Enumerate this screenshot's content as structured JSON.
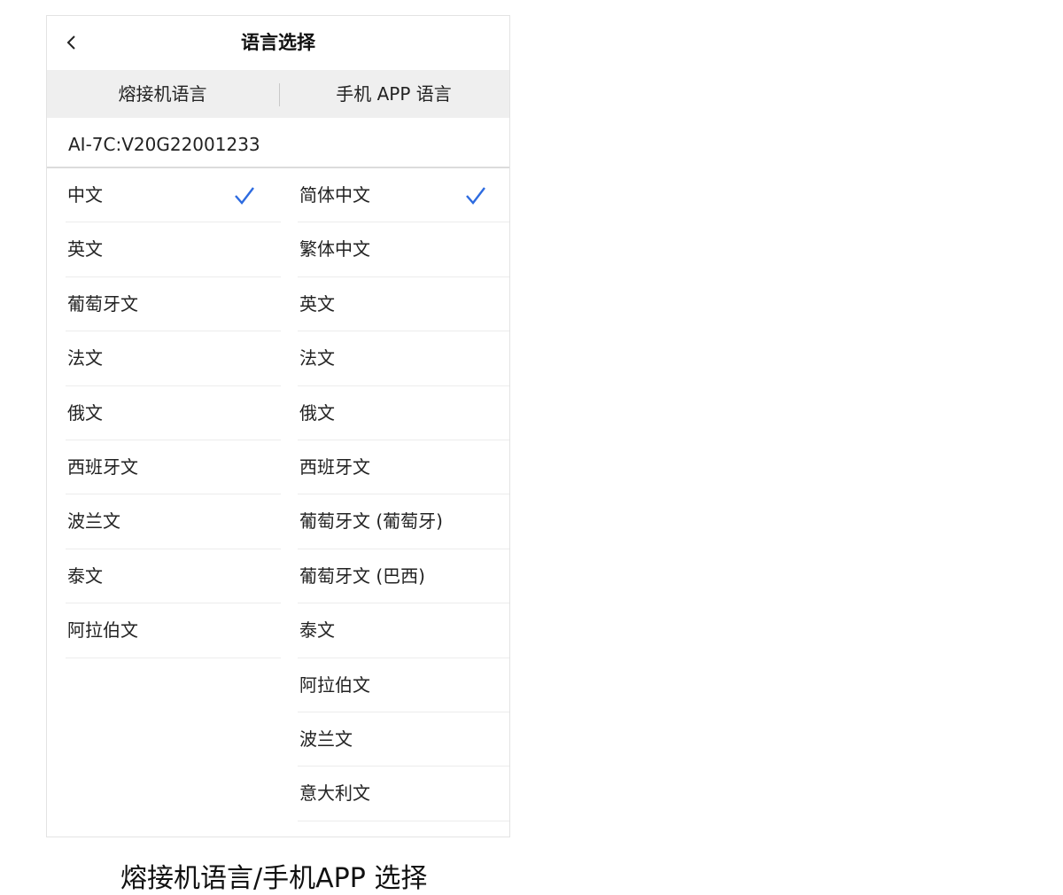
{
  "header": {
    "title": "语言选择"
  },
  "tabs": [
    "熔接机语言",
    "手机 APP 语言"
  ],
  "version": "AI-7C:V20G22001233",
  "machine_languages": [
    {
      "label": "中文",
      "selected": true
    },
    {
      "label": "英文",
      "selected": false
    },
    {
      "label": "葡萄牙文",
      "selected": false
    },
    {
      "label": "法文",
      "selected": false
    },
    {
      "label": "俄文",
      "selected": false
    },
    {
      "label": "西班牙文",
      "selected": false
    },
    {
      "label": "波兰文",
      "selected": false
    },
    {
      "label": "泰文",
      "selected": false
    },
    {
      "label": "阿拉伯文",
      "selected": false
    }
  ],
  "app_languages": [
    {
      "label": "简体中文",
      "selected": true
    },
    {
      "label": "繁体中文",
      "selected": false
    },
    {
      "label": "英文",
      "selected": false
    },
    {
      "label": "法文",
      "selected": false
    },
    {
      "label": "俄文",
      "selected": false
    },
    {
      "label": "西班牙文",
      "selected": false
    },
    {
      "label": "葡萄牙文 (葡萄牙)",
      "selected": false
    },
    {
      "label": "葡萄牙文 (巴西)",
      "selected": false
    },
    {
      "label": "泰文",
      "selected": false
    },
    {
      "label": "阿拉伯文",
      "selected": false
    },
    {
      "label": "波兰文",
      "selected": false
    },
    {
      "label": "意大利文",
      "selected": false
    }
  ],
  "caption": "熔接机语言/手机APP 选择",
  "colors": {
    "accent": "#2d6be0",
    "tab_bg": "#efefef",
    "divider": "#ececec"
  },
  "icons": {
    "back": "chevron-left-icon",
    "check": "checkmark-icon"
  }
}
